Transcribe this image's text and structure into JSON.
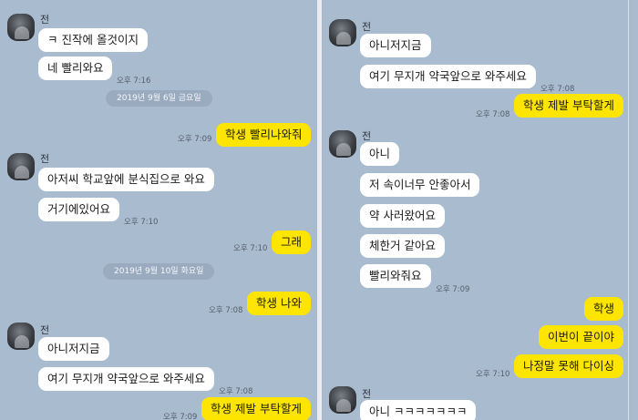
{
  "left": {
    "items": [
      {
        "type": "sender",
        "name": "전",
        "avatar": "profile-avatar"
      },
      {
        "type": "in",
        "text": "ㅋ 진작에 올것이지"
      },
      {
        "type": "in",
        "text": "네 빨리와요",
        "time": "오후 7:16"
      },
      {
        "type": "date",
        "text": "2019년 9월 6일 금요일"
      },
      {
        "type": "out",
        "text": "학생 빨리나와줘",
        "time": "오후 7:09"
      },
      {
        "type": "sender",
        "name": "전"
      },
      {
        "type": "in",
        "text": "아저씨 학교앞에 분식집으로 와요"
      },
      {
        "type": "in",
        "text": "거기에있어요",
        "time": "오후 7:10"
      },
      {
        "type": "out",
        "text": "그래",
        "time": "오후 7:10"
      },
      {
        "type": "date",
        "text": "2019년 9월 10일 화요일"
      },
      {
        "type": "out",
        "text": "학생 나와",
        "time": "오후 7:08"
      },
      {
        "type": "sender",
        "name": "전"
      },
      {
        "type": "in",
        "text": "아니저지금"
      },
      {
        "type": "in",
        "text": "여기 무지개 약국앞으로 와주세요",
        "time": "오후 7:08"
      },
      {
        "type": "out",
        "text": "학생 제발 부탁할게",
        "time": "오후 7:09"
      }
    ]
  },
  "right": {
    "items": [
      {
        "type": "sender",
        "name": "전"
      },
      {
        "type": "in",
        "text": "아니저지금"
      },
      {
        "type": "in",
        "text": "여기 무지개 약국앞으로 와주세요",
        "time": "오후 7:08"
      },
      {
        "type": "out",
        "text": "학생 제발 부탁할게",
        "time": "오후 7:08"
      },
      {
        "type": "sender",
        "name": "전"
      },
      {
        "type": "in",
        "text": "아니"
      },
      {
        "type": "in",
        "text": "저 속이너무 안좋아서"
      },
      {
        "type": "in",
        "text": "약 사러왔어요"
      },
      {
        "type": "in",
        "text": "체한거 같아요"
      },
      {
        "type": "in",
        "text": "빨리와줘요",
        "time": "오후 7:09"
      },
      {
        "type": "out",
        "text": "학생"
      },
      {
        "type": "out",
        "text": "이번이 끝이야"
      },
      {
        "type": "out",
        "text": "나정말 못해 다이싱",
        "time": "오후 7:10"
      },
      {
        "type": "sender",
        "name": "전"
      },
      {
        "type": "in",
        "text": "아니 ㅋㅋㅋㅋㅋㅋㅋ"
      }
    ]
  }
}
